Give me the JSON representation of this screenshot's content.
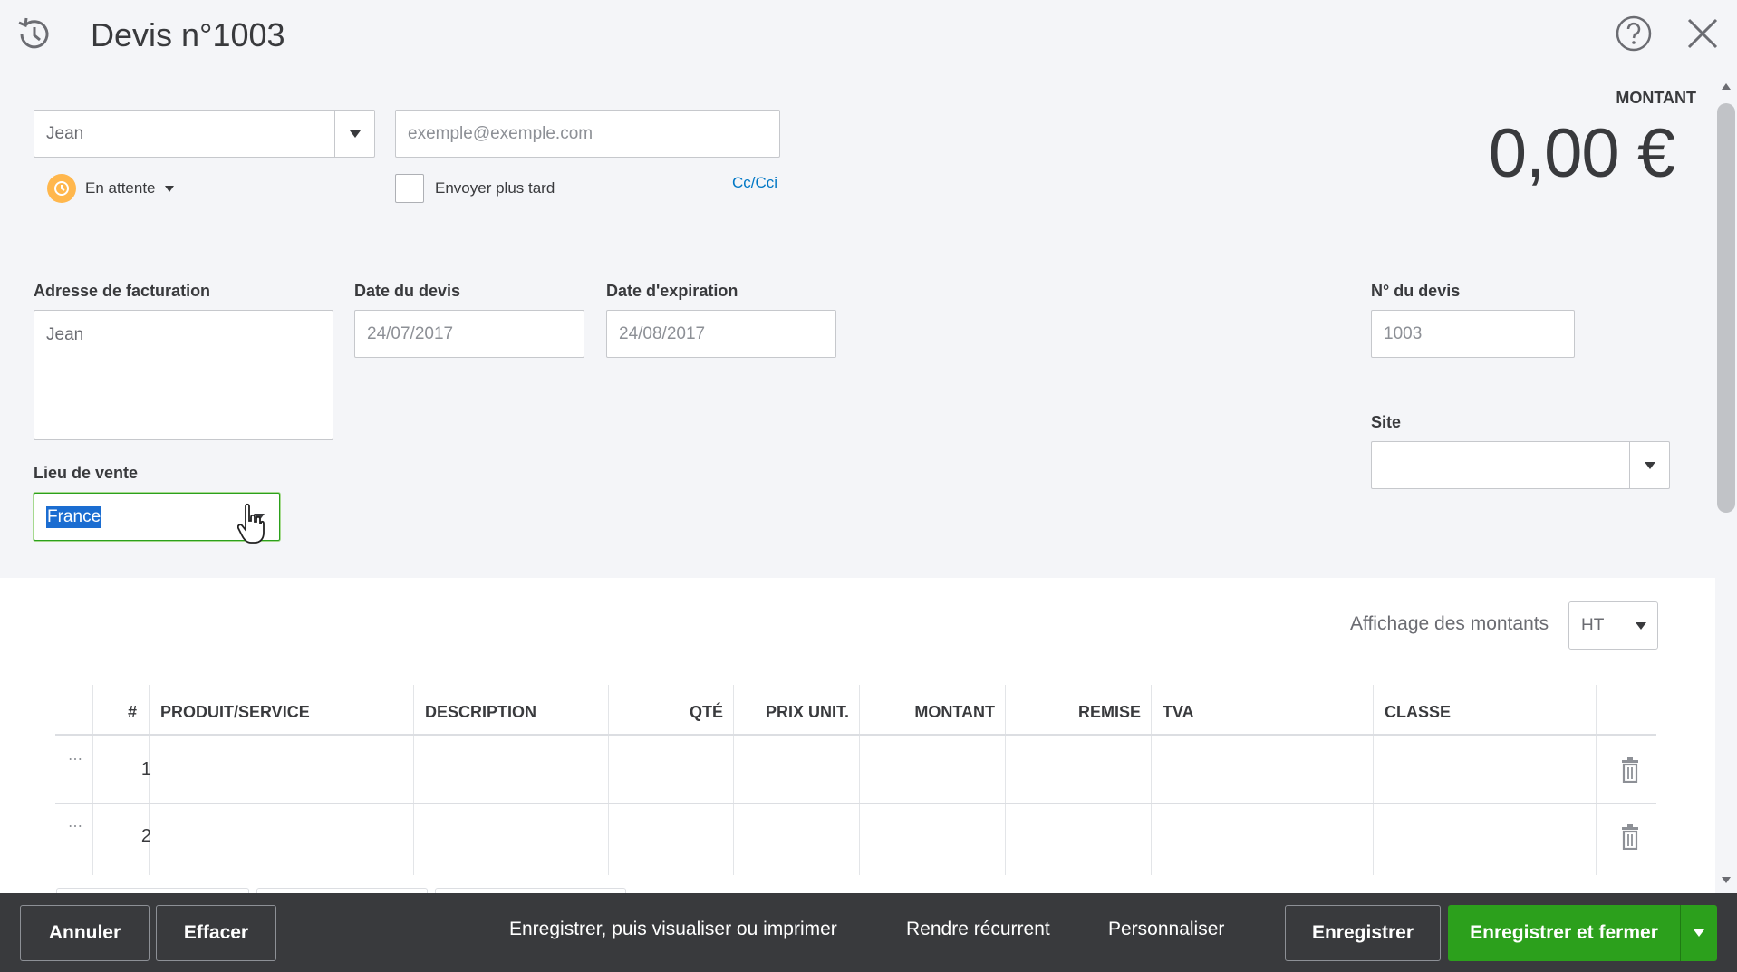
{
  "header": {
    "title": "Devis n°1003"
  },
  "customer": {
    "value": "Jean"
  },
  "email": {
    "placeholder": "exemple@exemple.com"
  },
  "status": {
    "label": "En attente"
  },
  "send_later": {
    "label": "Envoyer plus tard",
    "checked": false
  },
  "cc_link": "Cc/Cci",
  "amount": {
    "label": "MONTANT",
    "value": "0,00 €"
  },
  "billing": {
    "label": "Adresse de facturation",
    "value": "Jean"
  },
  "quote_date": {
    "label": "Date du devis",
    "value": "24/07/2017"
  },
  "expiry_date": {
    "label": "Date d'expiration",
    "value": "24/08/2017"
  },
  "quote_number": {
    "label": "N° du devis",
    "value": "1003"
  },
  "site": {
    "label": "Site",
    "value": ""
  },
  "place_of_sale": {
    "label": "Lieu de vente",
    "value": "France"
  },
  "amounts_display": {
    "label": "Affichage des montants",
    "value": "HT"
  },
  "table": {
    "headers": {
      "num": "#",
      "product": "PRODUIT/SERVICE",
      "description": "DESCRIPTION",
      "qty": "QTÉ",
      "unit_price": "PRIX UNIT.",
      "amount": "MONTANT",
      "discount": "REMISE",
      "vat": "TVA",
      "class": "CLASSE"
    },
    "rows": [
      {
        "num": "1"
      },
      {
        "num": "2"
      }
    ]
  },
  "footer": {
    "cancel": "Annuler",
    "clear": "Effacer",
    "save_view_print": "Enregistrer, puis visualiser ou imprimer",
    "make_recurring": "Rendre récurrent",
    "customize": "Personnaliser",
    "save": "Enregistrer",
    "save_close": "Enregistrer et fermer"
  },
  "colors": {
    "accent_green": "#2ca01c",
    "link_blue": "#0077c5",
    "status_orange": "#ffb74d",
    "footer_bg": "#393a3d"
  }
}
